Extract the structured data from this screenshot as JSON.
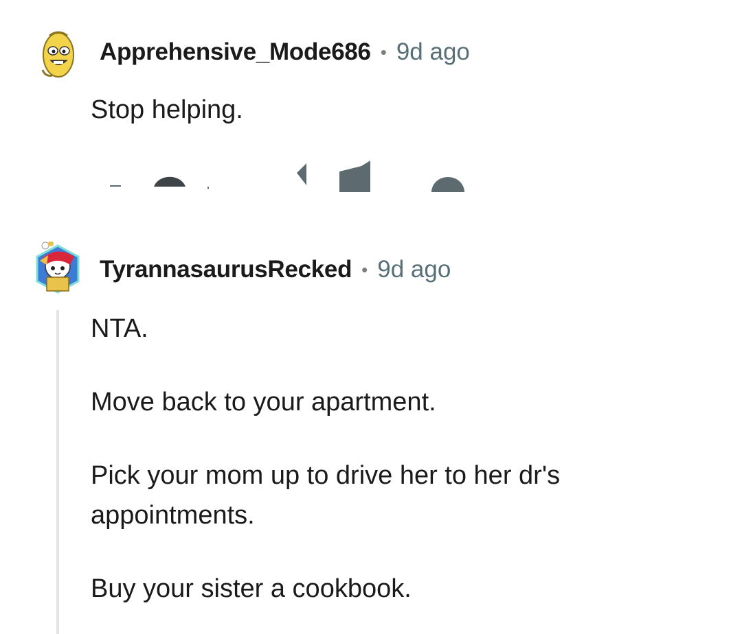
{
  "comments": [
    {
      "username": "Apprehensive_Mode686",
      "separator": "•",
      "time": "9d ago",
      "avatar_icon": "banana-avatar-icon",
      "paragraphs": [
        "Stop helping."
      ]
    },
    {
      "username": "TyrannasaurusRecked",
      "separator": "•",
      "time": "9d ago",
      "avatar_icon": "cat-samurai-avatar-icon",
      "paragraphs": [
        "NTA.",
        "Move back to your apartment.",
        "Pick your mom up to drive her to her dr's appointments.",
        "Buy your sister a cookbook."
      ]
    }
  ],
  "colors": {
    "username": "#1a1a1b",
    "timestamp": "#576f76",
    "body_text": "#1a1a1b",
    "action_icons": "#5d6b70",
    "thread_line": "#e4e4e4"
  }
}
